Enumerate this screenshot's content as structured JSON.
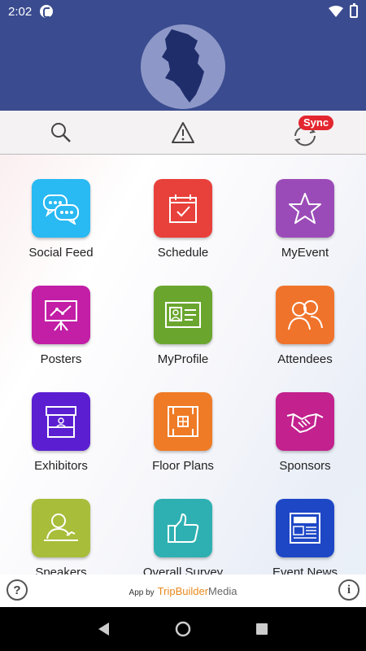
{
  "status": {
    "time": "2:02"
  },
  "toolbar": {
    "sync_badge": "Sync"
  },
  "tiles": [
    {
      "label": "Social Feed",
      "icon": "chat-bubbles-icon",
      "color": "#29b9f3"
    },
    {
      "label": "Schedule",
      "icon": "calendar-icon",
      "color": "#e8403a"
    },
    {
      "label": "MyEvent",
      "icon": "star-icon",
      "color": "#9b4bb8"
    },
    {
      "label": "Posters",
      "icon": "presentation-board-icon",
      "color": "#c21ea6"
    },
    {
      "label": "MyProfile",
      "icon": "id-card-icon",
      "color": "#6aa62e"
    },
    {
      "label": "Attendees",
      "icon": "people-icon",
      "color": "#f0732b"
    },
    {
      "label": "Exhibitors",
      "icon": "booth-icon",
      "color": "#5b1fd1"
    },
    {
      "label": "Floor Plans",
      "icon": "floor-plan-icon",
      "color": "#ef7b26"
    },
    {
      "label": "Sponsors",
      "icon": "handshake-icon",
      "color": "#c2218e"
    },
    {
      "label": "Speakers",
      "icon": "speaker-icon",
      "color": "#a8bd3a"
    },
    {
      "label": "Overall Survey",
      "icon": "thumbs-up-icon",
      "color": "#2eb0b2"
    },
    {
      "label": "Event News",
      "icon": "newspaper-icon",
      "color": "#1e47c6"
    }
  ],
  "footer": {
    "help": "?",
    "info": "i",
    "credit_prefix": "App by",
    "brand_a": "TripBuilder",
    "brand_b": "Media"
  }
}
